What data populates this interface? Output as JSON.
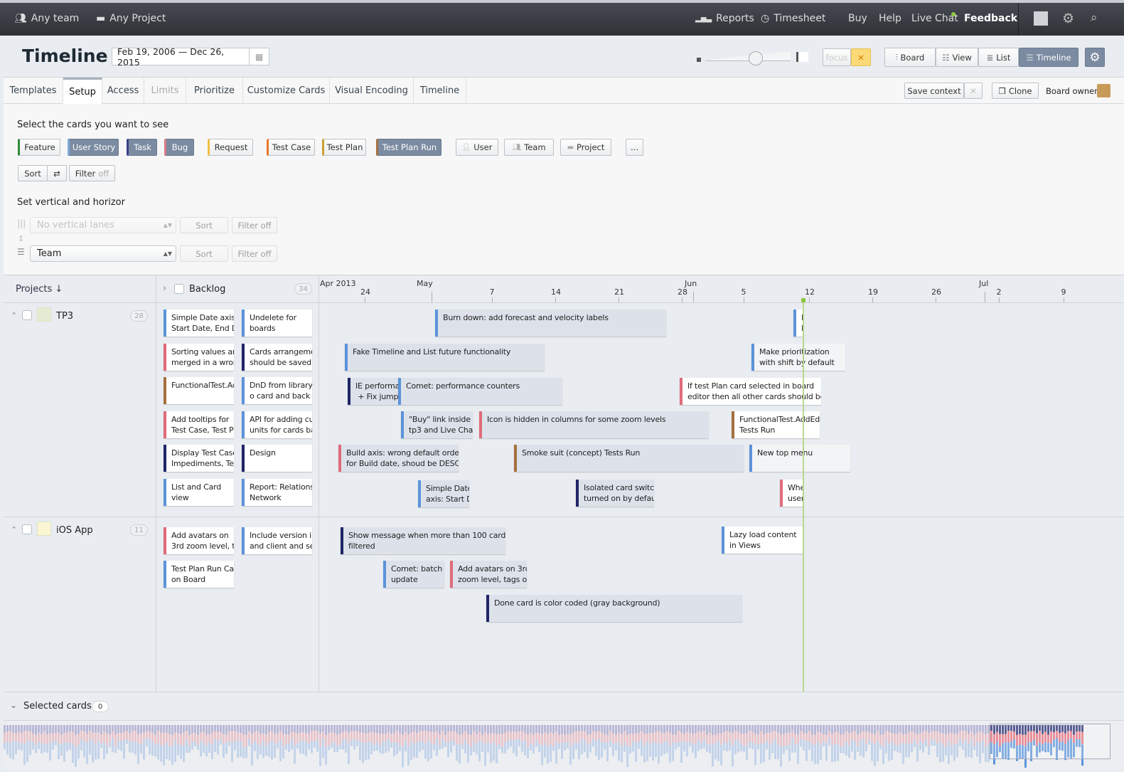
{
  "topbar": {
    "team": "Any team",
    "project": "Any Project",
    "reports": "Reports",
    "timesheet": "Timesheet",
    "buy": "Buy",
    "help": "Help",
    "live_chat": "Live Chat",
    "feedback": "Feedback",
    "live_chat_indicator_color": "#8dc63f"
  },
  "header": {
    "title": "Timeline",
    "date_range": "Feb 19, 2006 — Dec 26, 2015",
    "focus": "focus",
    "views": [
      "Board",
      "View",
      "List",
      "Timeline"
    ],
    "active_view": "Timeline",
    "zoom_level": 0.5
  },
  "tabs": [
    {
      "label": "Templates"
    },
    {
      "label": "Setup",
      "active": true
    },
    {
      "label": "Access"
    },
    {
      "label": "Limits",
      "disabled": true
    },
    {
      "label": "Prioritize"
    },
    {
      "label": "Customize Cards"
    },
    {
      "label": "Visual Encoding"
    },
    {
      "label": "Timeline"
    }
  ],
  "context": {
    "save": "Save context",
    "clone": "Clone",
    "owner": "Board owner"
  },
  "setup": {
    "cards_heading": "Select the cards you want to see",
    "card_types": [
      {
        "label": "Feature",
        "color": "#2e8b3a",
        "selected": false
      },
      {
        "label": "User Story",
        "color": "#7fa8d8",
        "selected": true
      },
      {
        "label": "Task",
        "color": "#3a3f8a",
        "selected": true
      },
      {
        "label": "Bug",
        "color": "#d87a86",
        "selected": true
      },
      {
        "label": "Request",
        "color": "#f0c040",
        "selected": false
      },
      {
        "label": "Test Case",
        "color": "#e8782a",
        "selected": false
      },
      {
        "label": "Test Plan",
        "color": "#c9a030",
        "selected": false
      },
      {
        "label": "Test Plan Run",
        "color": "#a4703e",
        "selected": true
      },
      {
        "label": "User",
        "selected": false
      },
      {
        "label": "Team",
        "selected": false
      },
      {
        "label": "Project",
        "selected": false
      },
      {
        "label": "...",
        "selected": false
      }
    ],
    "sort": "Sort",
    "filter": "Filter",
    "filter_state": "off",
    "lanes_heading": "Set vertical and horizor",
    "vertical_lanes": "No vertical lanes",
    "horizontal_lanes": "Team",
    "lane_sort": "Sort",
    "lane_filter": "Filter off"
  },
  "timeline": {
    "lane_header": "Projects ↓",
    "backlog_label": "Backlog",
    "backlog_count": "34",
    "months": [
      "Apr 2013",
      "May",
      "Jun",
      "Jul"
    ],
    "ticks": [
      "24",
      "7",
      "14",
      "21",
      "28",
      "5",
      "12",
      "19",
      "26",
      "2",
      "9"
    ],
    "today_color": "#8dc63f",
    "lanes": [
      {
        "name": "TP3",
        "count": "28",
        "color": "#e3ecd2",
        "backlog": [
          "Simple Date axis:\nStart Date, End Da",
          "Undelete for\nboards",
          "Sorting values are\nmerged in a wron",
          "Cards arrangeme\nshould be saved a",
          "FunctionalTest.Ad",
          "DnD from library\no card and back t",
          "Add tooltips for\nTest Case, Test Pl",
          "API for adding cus\nunits for cards ba",
          "Display Test Case:\nImpediments, Tea",
          "Design",
          "List and Card\nview",
          "Report: Relations\nNetwork"
        ],
        "cards": [
          "Burn down: add forecast and velocity labels",
          "H\nE",
          "Fake Timeline and List future functionality",
          "Make prioritization\nwith shift by default",
          "IE performa\n + Fix jumpi",
          "Comet: performance counters",
          "If test Plan card selected in board\neditor then all other cards should be",
          "\"Buy\" link inside\ntp3 and Live Chat",
          "Icon is hidden in columns for some zoom levels",
          "FunctionalTest.AddEdi\nTests Run",
          "Build axis: wrong default order\nfor Build date, shoud be DESC b",
          "Smoke suit (concept) Tests Run",
          "New top menu",
          "Simple Date\naxis: Start D",
          "Isolated card switch\nturned on by defau",
          "Whe\nuser"
        ]
      },
      {
        "name": "iOS App",
        "count": "11",
        "color": "#fbf6d2",
        "backlog": [
          "Add avatars on\n3rd zoom level, ta",
          "Include version in\nand client and ser",
          "Test Plan Run Car\non Board"
        ],
        "cards": [
          "Show message when more than 100 cards\nfiltered",
          "Lazy load content\nin Views",
          "Comet: batch\nupdate",
          "Add avatars on 3rd\nzoom level, tags on",
          "Done card is color coded (gray background)"
        ]
      }
    ]
  },
  "selected": {
    "label": "Selected cards",
    "count": "0"
  }
}
